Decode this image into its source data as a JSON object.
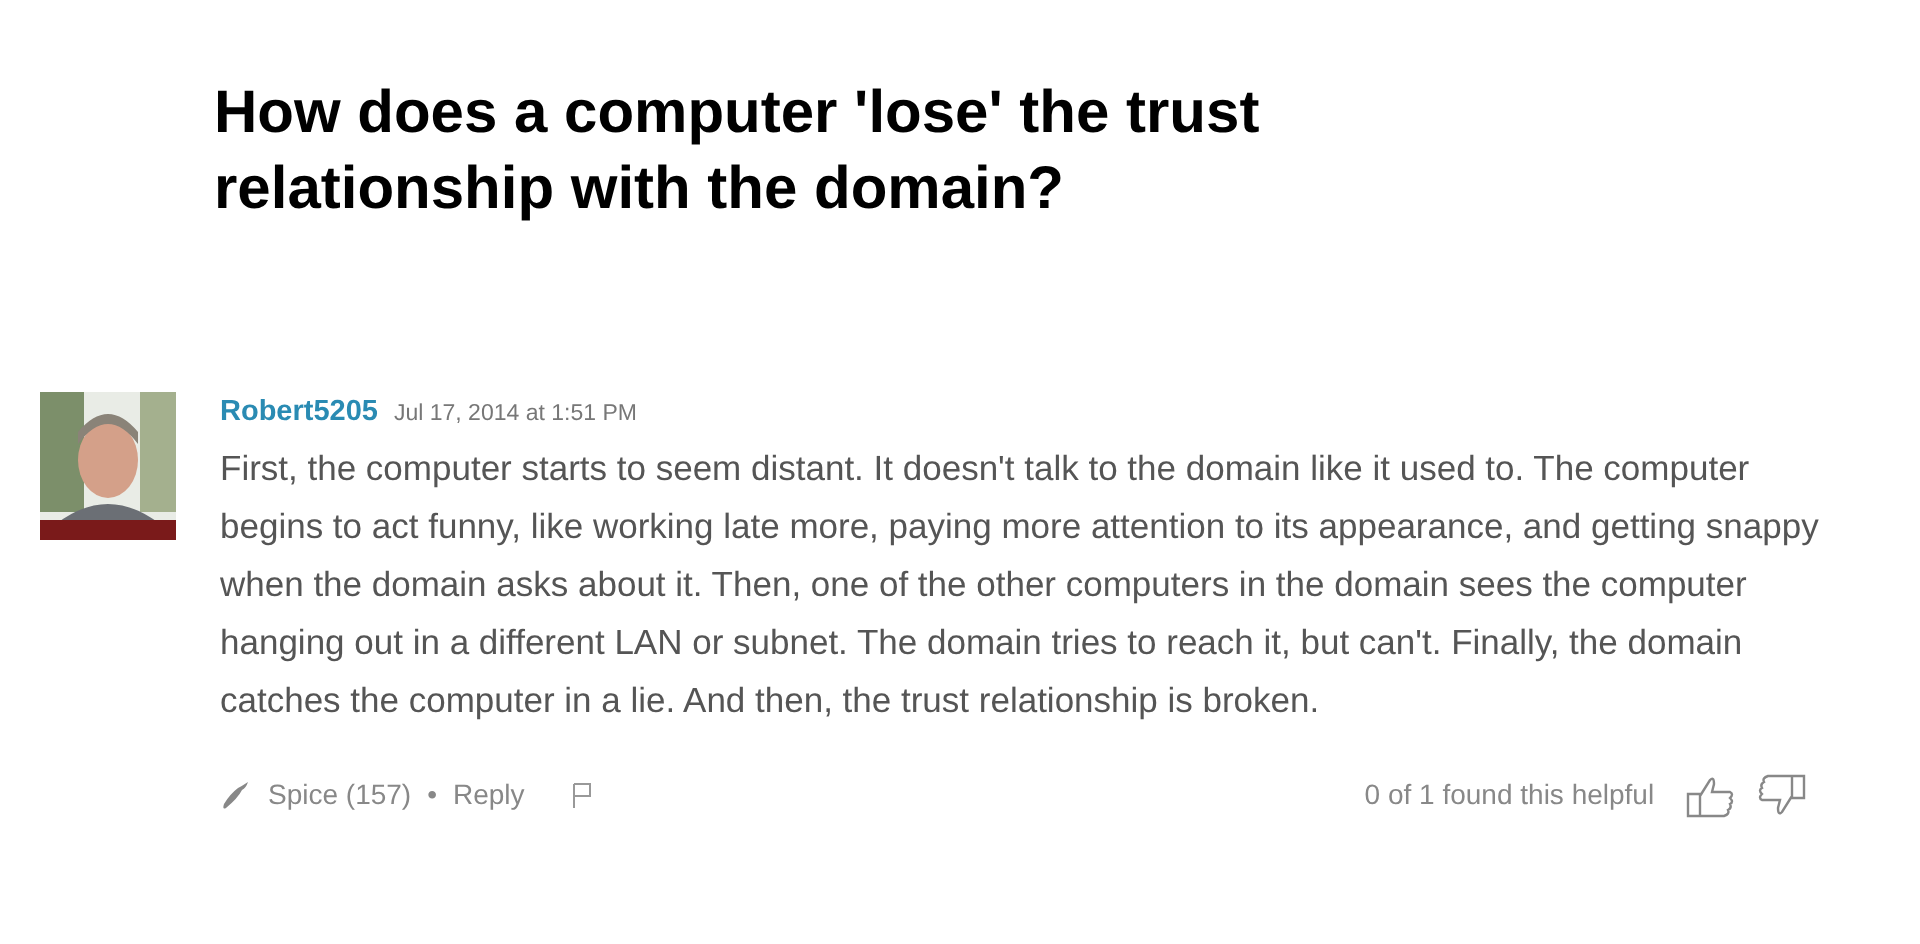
{
  "question": {
    "title": "How does a computer 'lose' the trust relationship with the domain?"
  },
  "answer": {
    "author": "Robert5205",
    "timestamp": "Jul 17, 2014 at 1:51 PM",
    "body": "First, the computer starts to seem distant. It doesn't talk to the domain like it used to. The computer begins to act funny, like working late more, paying more attention to its appearance, and getting snappy when the domain asks about it. Then, one of the other computers in the domain sees the computer hanging out in a different LAN or subnet. The domain tries to reach it, but can't. Finally, the domain catches the computer in a lie. And then, the trust relationship is broken.",
    "spice": "Spice (157)",
    "separator": "•",
    "reply": "Reply",
    "helpful": "0 of 1 found this helpful"
  }
}
